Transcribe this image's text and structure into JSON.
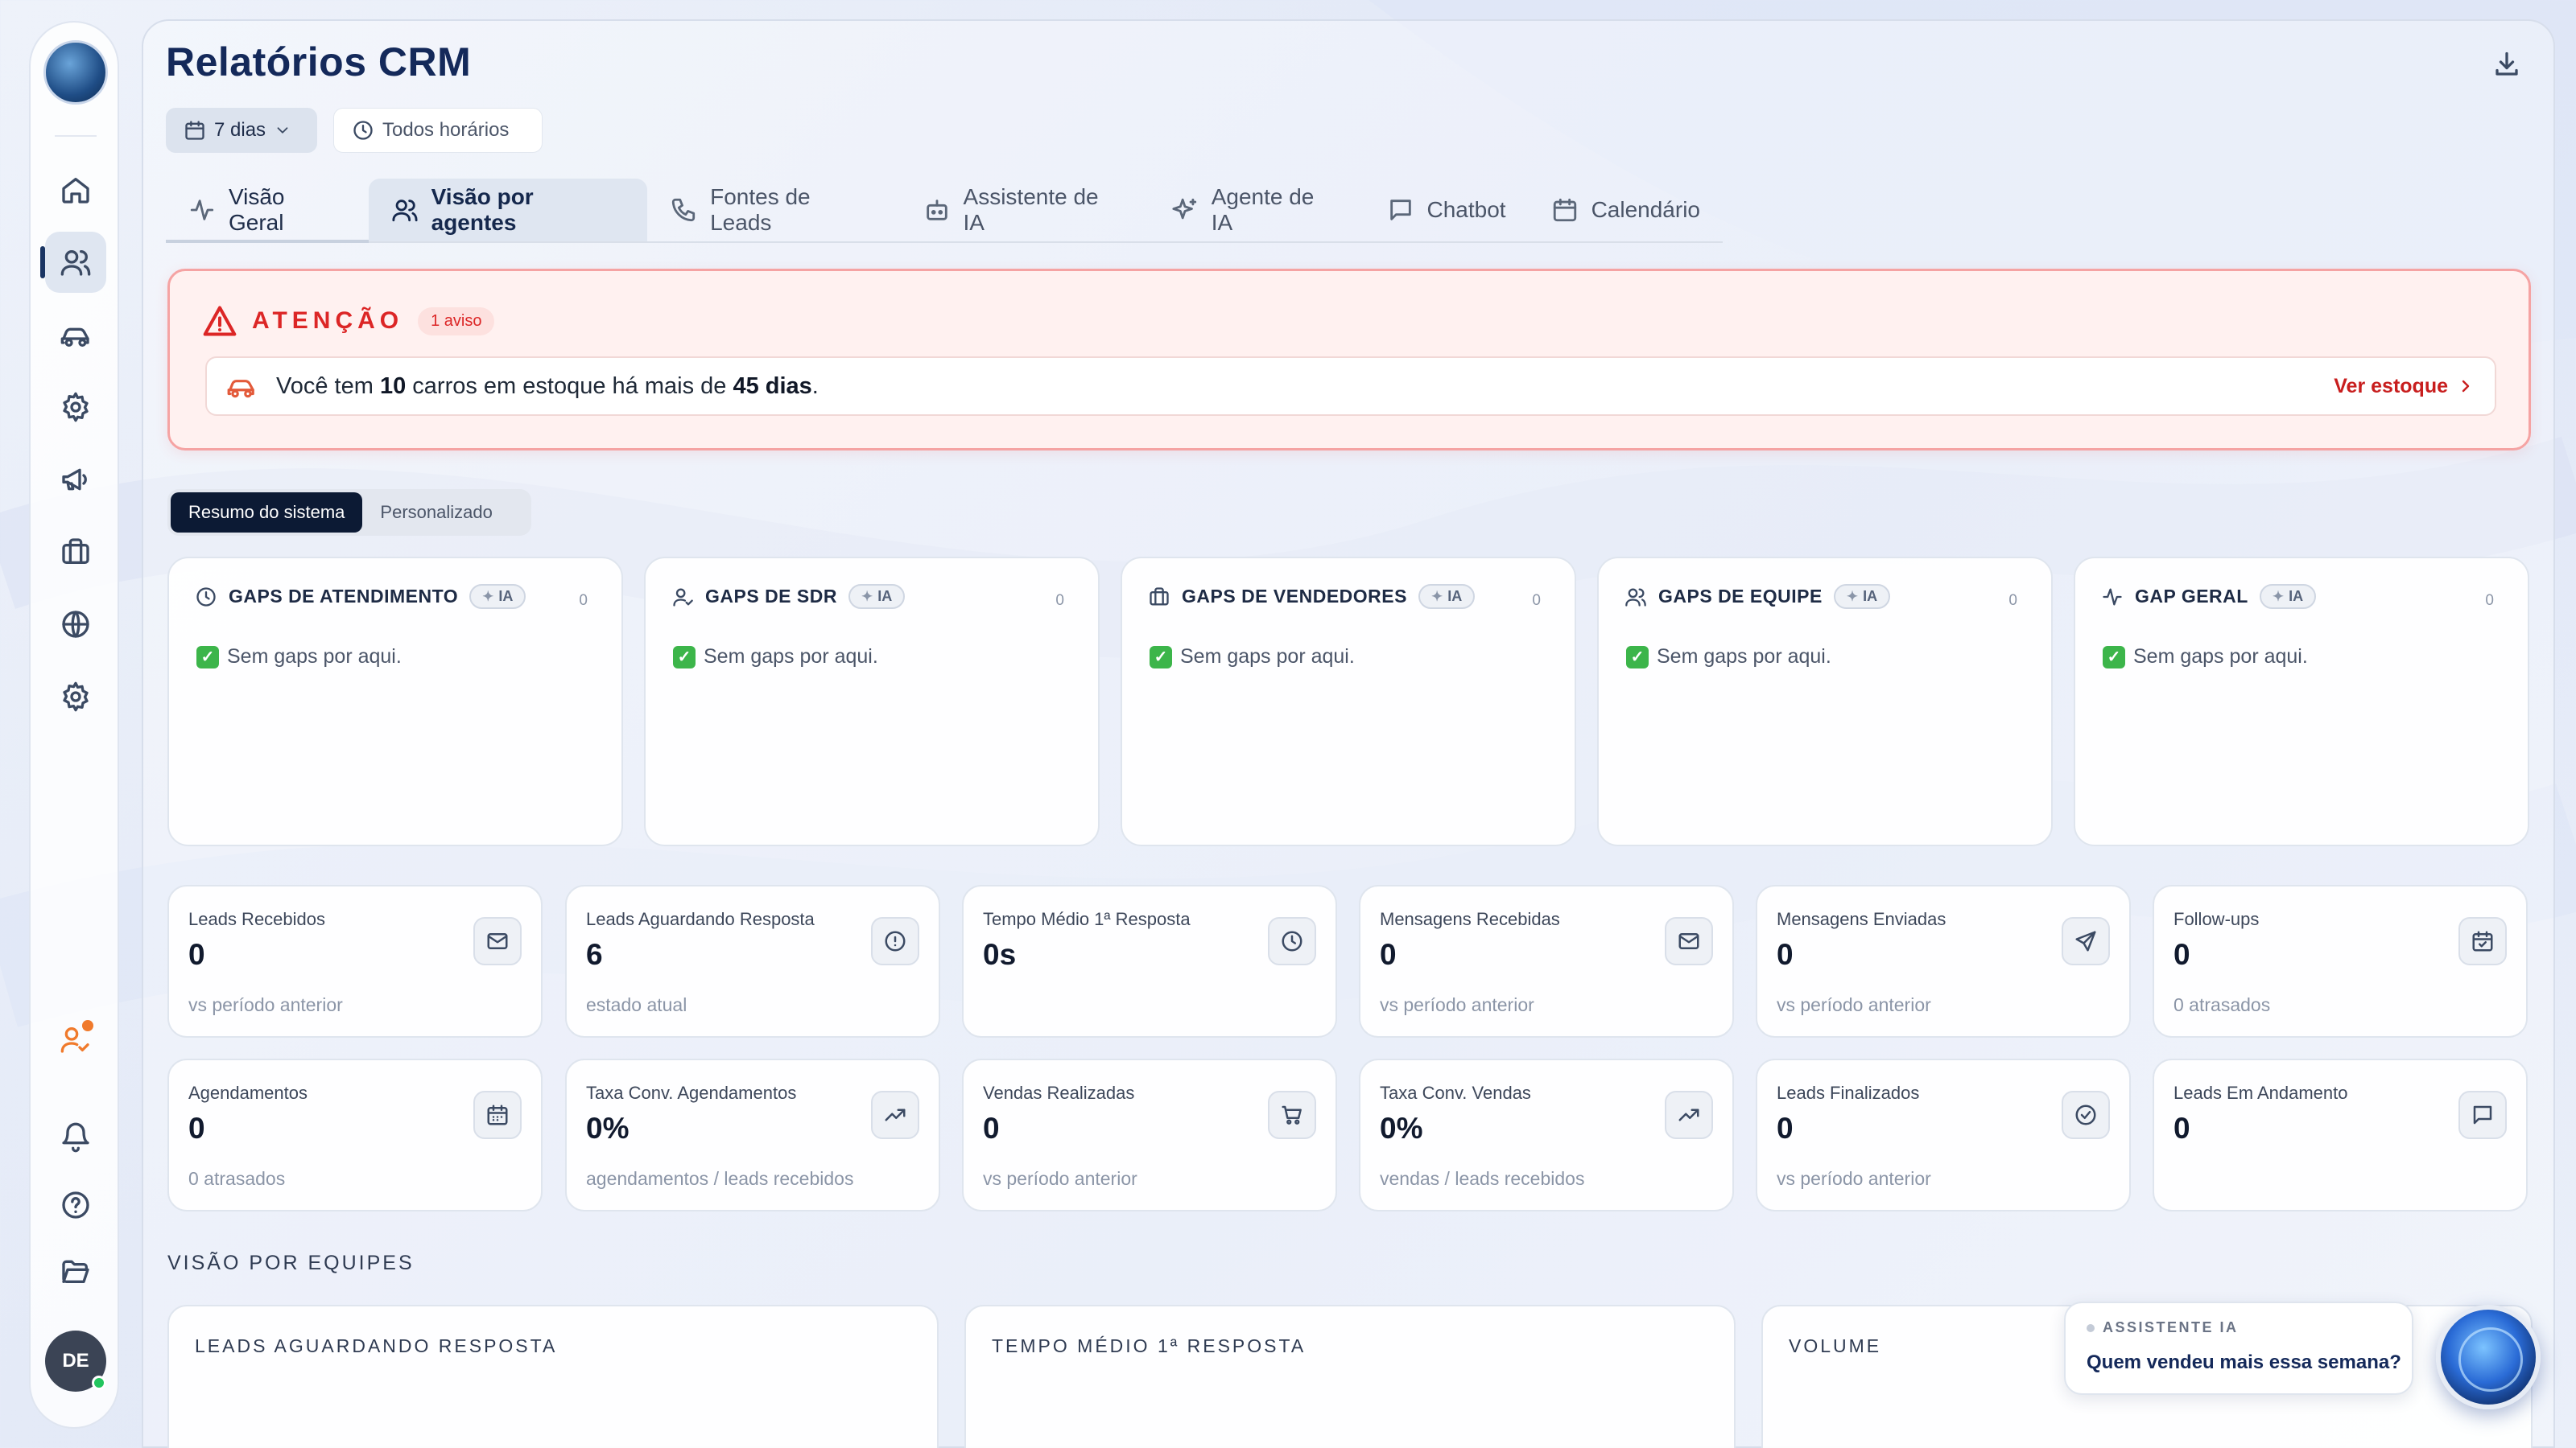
{
  "page": {
    "title": "Relatórios CRM"
  },
  "filters": {
    "period": "7 dias",
    "hours": "Todos horários"
  },
  "tabs": [
    {
      "label": "Visão Geral",
      "icon": "activity-icon"
    },
    {
      "label": "Visão por agentes",
      "icon": "users-icon"
    },
    {
      "label": "Fontes de Leads",
      "icon": "phone-icon"
    },
    {
      "label": "Assistente de IA",
      "icon": "bot-icon"
    },
    {
      "label": "Agente de IA",
      "icon": "sparkles-icon"
    },
    {
      "label": "Chatbot",
      "icon": "message-square-icon"
    },
    {
      "label": "Calendário",
      "icon": "calendar-icon"
    }
  ],
  "alert": {
    "title": "ATENÇÃO",
    "badge": "1 aviso",
    "msg_prefix": "Você tem",
    "cars": "10",
    "msg_middle": "carros em estoque há mais de",
    "days": "45 dias",
    "msg_suffix": ".",
    "link": "Ver estoque"
  },
  "view_toggle": {
    "system": "Resumo do sistema",
    "custom": "Personalizado"
  },
  "gaps": [
    {
      "title": "GAPS DE ATENDIMENTO",
      "ia": "IA",
      "count": "0",
      "empty": "Sem gaps por aqui."
    },
    {
      "title": "GAPS DE SDR",
      "ia": "IA",
      "count": "0",
      "empty": "Sem gaps por aqui."
    },
    {
      "title": "GAPS DE VENDEDORES",
      "ia": "IA",
      "count": "0",
      "empty": "Sem gaps por aqui."
    },
    {
      "title": "GAPS DE EQUIPE",
      "ia": "IA",
      "count": "0",
      "empty": "Sem gaps por aqui."
    },
    {
      "title": "GAP GERAL",
      "ia": "IA",
      "count": "0",
      "empty": "Sem gaps por aqui."
    }
  ],
  "metrics": [
    {
      "label": "Leads Recebidos",
      "value": "0",
      "sub": "vs período anterior",
      "icon": "mail-icon"
    },
    {
      "label": "Leads Aguardando Resposta",
      "value": "6",
      "sub": "estado atual",
      "icon": "alert-circle-icon"
    },
    {
      "label": "Tempo Médio 1ª Resposta",
      "value": "0s",
      "sub": "",
      "icon": "clock-icon"
    },
    {
      "label": "Mensagens Recebidas",
      "value": "0",
      "sub": "vs período anterior",
      "icon": "mail-icon"
    },
    {
      "label": "Mensagens Enviadas",
      "value": "0",
      "sub": "vs período anterior",
      "icon": "send-icon"
    },
    {
      "label": "Follow-ups",
      "value": "0",
      "sub": "0 atrasados",
      "icon": "calendar-check-icon"
    },
    {
      "label": "Agendamentos",
      "value": "0",
      "sub": "0 atrasados",
      "icon": "calendar-icon"
    },
    {
      "label": "Taxa Conv. Agendamentos",
      "value": "0%",
      "sub": "agendamentos / leads recebidos",
      "icon": "trending-up-icon"
    },
    {
      "label": "Vendas Realizadas",
      "value": "0",
      "sub": "vs período anterior",
      "icon": "cart-icon"
    },
    {
      "label": "Taxa Conv. Vendas",
      "value": "0%",
      "sub": "vendas / leads recebidos",
      "icon": "trending-up-icon"
    },
    {
      "label": "Leads Finalizados",
      "value": "0",
      "sub": "vs período anterior",
      "icon": "check-circle-icon"
    },
    {
      "label": "Leads Em Andamento",
      "value": "0",
      "sub": "",
      "icon": "message-square-icon"
    }
  ],
  "teams": {
    "title": "VISÃO POR EQUIPES",
    "cards": [
      "LEADS AGUARDANDO RESPOSTA",
      "TEMPO MÉDIO 1ª RESPOSTA",
      "VOLUME"
    ]
  },
  "assistant": {
    "label": "ASSISTENTE IA",
    "question": "Quem vendeu mais essa semana?"
  },
  "user": {
    "initials": "DE"
  },
  "colors": {
    "alert_red": "#dc2626",
    "accent_navy": "#14295a",
    "online_green": "#22c55e",
    "notify_orange": "#f07a2c"
  }
}
